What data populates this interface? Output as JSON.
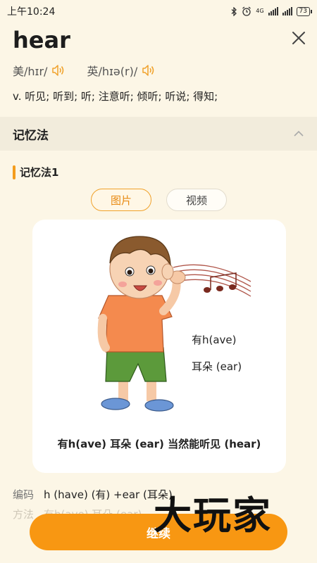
{
  "status_bar": {
    "time": "上午10:24",
    "network": "4G",
    "battery": "73"
  },
  "word": {
    "title": "hear",
    "us_label": "美/hɪr/",
    "uk_label": "英/hɪə(r)/",
    "meaning": "v. 听见; 听到; 听; 注意听; 倾听; 听说; 得知;"
  },
  "section": {
    "title": "记忆法"
  },
  "mnemonic": {
    "label": "记忆法1",
    "tabs": [
      "图片",
      "视频"
    ],
    "active_tab": "图片",
    "image_text_1": "有h(ave)",
    "image_text_2": "耳朵 (ear)",
    "image_caption": "有h(ave) 耳朵 (ear) 当然能听见 (hear)"
  },
  "details": {
    "code_key": "编码",
    "code_value": "h (have) (有) +ear (耳朵)",
    "method_key": "方法",
    "method_value": "有h(ave) 耳朵 (ear)"
  },
  "actions": {
    "continue_label": "继续"
  },
  "watermark": "大玩家",
  "colors": {
    "accent": "#f89712",
    "background": "#fcf6e6",
    "section_bg": "#f2ecdc"
  }
}
